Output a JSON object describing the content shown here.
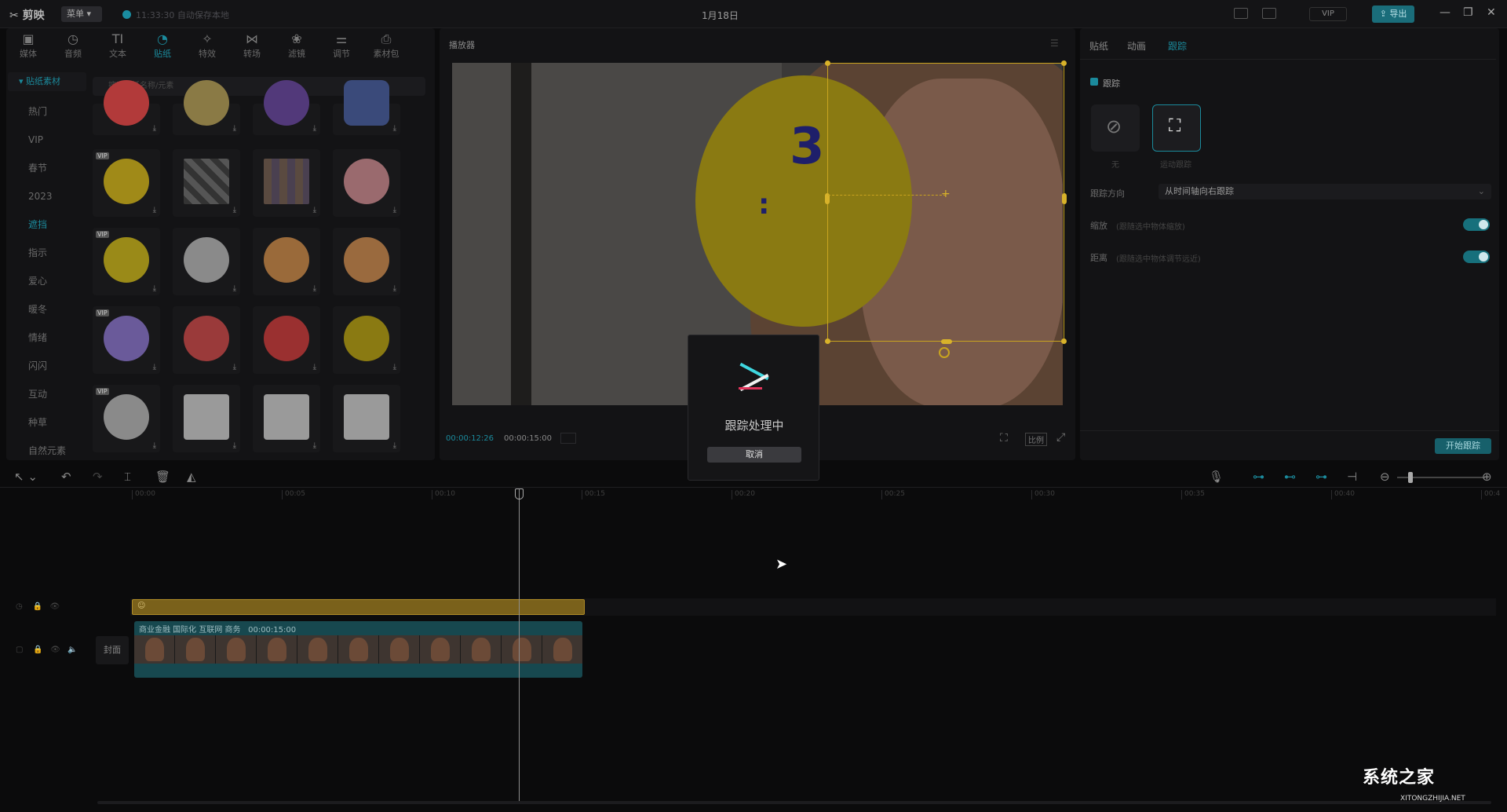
{
  "titlebar": {
    "logo": "剪映",
    "menu": "菜单",
    "save_status": "11:33:30 自动保存本地",
    "title": "1月18日",
    "vip": "VIP",
    "export": "导出"
  },
  "tool_tabs": [
    {
      "label": "媒体",
      "icon": "media-icon"
    },
    {
      "label": "音频",
      "icon": "audio-icon"
    },
    {
      "label": "文本",
      "icon": "text-icon"
    },
    {
      "label": "贴纸",
      "icon": "sticker-icon"
    },
    {
      "label": "特效",
      "icon": "effects-icon"
    },
    {
      "label": "转场",
      "icon": "transition-icon"
    },
    {
      "label": "滤镜",
      "icon": "filter-icon"
    },
    {
      "label": "调节",
      "icon": "adjust-icon"
    },
    {
      "label": "素材包",
      "icon": "package-icon"
    }
  ],
  "sidebar": {
    "header": "贴纸素材",
    "items": [
      "热门",
      "VIP",
      "春节",
      "2023",
      "遮挡",
      "指示",
      "爱心",
      "暖冬",
      "情绪",
      "闪闪",
      "互动",
      "种草",
      "自然元素"
    ]
  },
  "search": {
    "placeholder": "搜索贴纸名称/元素"
  },
  "stickers": {
    "vip_label": "VIP",
    "download": "⤓"
  },
  "player": {
    "title": "播放器",
    "time_current": "00:00:12:26",
    "time_total": "00:00:15:00",
    "ratio": "比例"
  },
  "props": {
    "tabs": [
      "贴纸",
      "动画",
      "跟踪"
    ],
    "tracking_label": "跟踪",
    "none_label": "无",
    "motion_label": "运动跟踪",
    "direction_label": "跟踪方向",
    "direction_value": "从时间轴向右跟踪",
    "scale_label": "缩放",
    "scale_hint": "(跟随选中物体缩放)",
    "distance_label": "距离",
    "distance_hint": "(跟随选中物体调节远近)",
    "start_button": "开始跟踪"
  },
  "timeline": {
    "ticks": [
      "00:00",
      "00:05",
      "00:10",
      "00:15",
      "00:20",
      "00:25",
      "00:30",
      "00:35",
      "00:40",
      "00:4"
    ],
    "cover": "封面",
    "video_clip_label": "商业金融 国际化 互联网 商务",
    "video_clip_duration": "00:00:15:00"
  },
  "dialog": {
    "title": "跟踪处理中",
    "cancel": "取消"
  },
  "watermark": {
    "brand": "系统之家",
    "url": "XITONGZHIJIA.NET"
  },
  "colors": {
    "accent": "#1b8a9c",
    "sticker_yellow": "#c9a41f"
  }
}
